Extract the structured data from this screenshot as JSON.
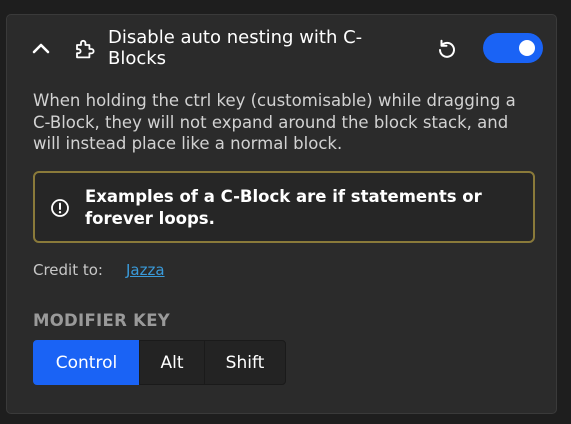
{
  "setting": {
    "title": "Disable auto nesting with C-Blocks",
    "enabled": true,
    "description": "When holding the ctrl key (customisable) while dragging a C-Block, they will not expand around the block stack, and will instead place like a normal block.",
    "notice": "Examples of a C-Block are if statements or forever loops.",
    "credit_label": "Credit to:",
    "credit_name": "Jazza"
  },
  "modifier": {
    "label": "MODIFIER KEY",
    "options": [
      "Control",
      "Alt",
      "Shift"
    ],
    "selected": "Control"
  },
  "icons": {
    "collapse": "chevron-up-icon",
    "addon": "puzzle-piece-icon",
    "reset": "reset-icon",
    "notice": "info-icon"
  },
  "colors": {
    "accent": "#1a63f5",
    "notice_border": "#8a7a3a",
    "link": "#3a9ad9"
  }
}
